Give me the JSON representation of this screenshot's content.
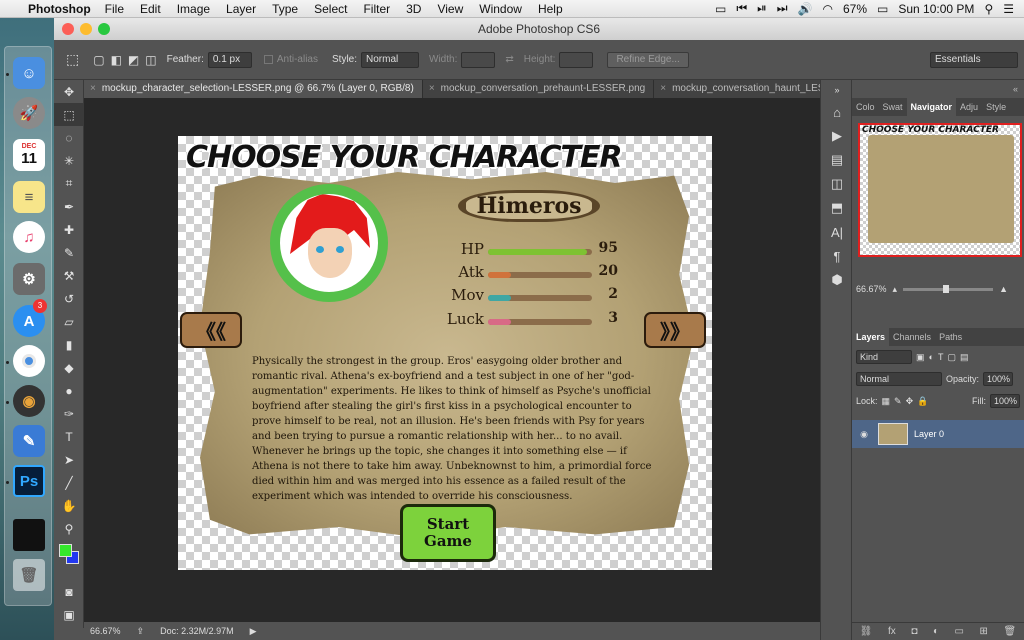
{
  "menubar": {
    "app_name": "Photoshop",
    "items": [
      "File",
      "Edit",
      "Image",
      "Layer",
      "Type",
      "Select",
      "Filter",
      "3D",
      "View",
      "Window",
      "Help"
    ],
    "battery": "67%",
    "clock": "Sun 10:00 PM"
  },
  "window": {
    "title": "Adobe Photoshop CS6",
    "options": {
      "feather_label": "Feather:",
      "feather_value": "0.1 px",
      "antialias_label": "Anti-alias",
      "style_label": "Style:",
      "style_value": "Normal",
      "width_label": "Width:",
      "height_label": "Height:",
      "refine_edge": "Refine Edge...",
      "workspace": "Essentials"
    },
    "tabs": [
      "mockup_character_selection-LESSER.png @ 66.7% (Layer 0, RGB/8)",
      "mockup_conversation_prehaunt-LESSER.png",
      "mockup_conversation_haunt_LESSER.png"
    ],
    "status": {
      "zoom": "66.67%",
      "doc": "Doc: 2.32M/2.97M"
    }
  },
  "dock": {
    "app_store_badge": "3",
    "calendar_month": "DEC",
    "calendar_day": "11"
  },
  "artwork": {
    "title": "CHOOSE YOUR CHARACTER",
    "character_name": "Himeros",
    "stats": [
      {
        "label": "HP",
        "value": "95",
        "level": 0.95,
        "color": "#7ec232"
      },
      {
        "label": "Atk",
        "value": "20",
        "level": 0.2,
        "color": "#d0723c"
      },
      {
        "label": "Mov",
        "value": "2",
        "level": 0.02,
        "color": "#3fa7a4"
      },
      {
        "label": "Luck",
        "value": "3",
        "level": 0.03,
        "color": "#d86a86"
      }
    ],
    "prev_arrow": "《《",
    "next_arrow": "》》",
    "bio": "Physically the strongest in the group. Eros' easygoing older brother and romantic rival. Athena's ex-boyfriend and a test subject in one of her \"god-augmentation\" experiments. He likes to think of himself as Psyche's unofficial boyfriend after stealing the girl's first kiss in a psychological encounter to prove himself to be real, not an illusion. He's been friends with Psy for years and been trying to pursue a romantic relationship with her... to no avail. Whenever he brings up the topic, she changes it into something else — if Athena is not there to take him away. Unbeknownst to him, a primordial force died within him and was merged into his essence as a failed result of the experiment which was intended to override his consciousness.",
    "start_button": "Start\nGame"
  },
  "panels": {
    "top_tabs": [
      "Colo",
      "Swat",
      "Navigator",
      "Adju",
      "Style"
    ],
    "navigator_zoom": "66.67%",
    "layers_tabs": [
      "Layers",
      "Channels",
      "Paths"
    ],
    "kind_label": "Kind",
    "blend_mode": "Normal",
    "opacity_label": "Opacity:",
    "opacity_value": "100%",
    "lock_label": "Lock:",
    "fill_label": "Fill:",
    "fill_value": "100%",
    "layer_name": "Layer 0"
  }
}
